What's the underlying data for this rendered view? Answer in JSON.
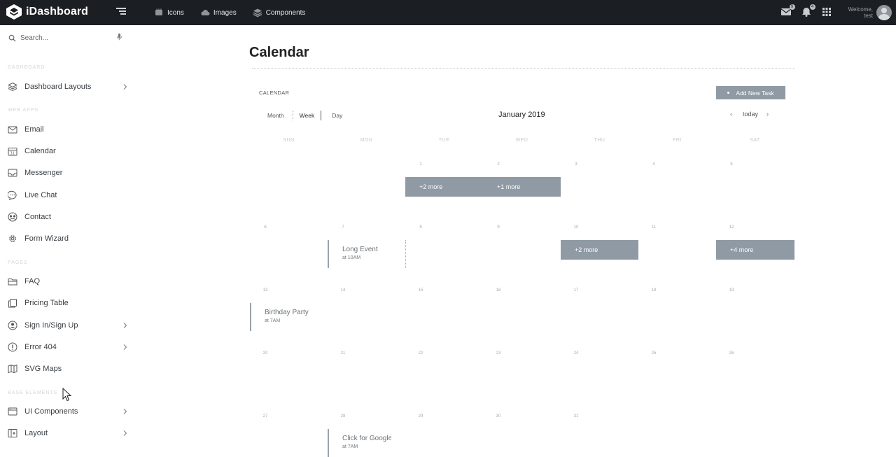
{
  "topbar": {
    "brand": "iDashboard",
    "nav": [
      {
        "label": "Icons",
        "icon": "icons-icon"
      },
      {
        "label": "Images",
        "icon": "cloud-icon"
      },
      {
        "label": "Components",
        "icon": "layers-icon"
      }
    ],
    "mail_badge": "9",
    "bell_badge": "4",
    "welcome": "Welcome,",
    "username": "test"
  },
  "sidebar": {
    "search_placeholder": "Search...",
    "sections": {
      "dashboard": "DASHBOARD",
      "web_apps": "WEB APPS",
      "pages": "PAGES",
      "base_elements": "BASE ELEMENTS"
    },
    "items": [
      {
        "label": "Dashboard Layouts",
        "icon": "layers-icon",
        "has_children": true
      },
      {
        "label": "Email",
        "icon": "mail-icon"
      },
      {
        "label": "Calendar",
        "icon": "calendar-icon"
      },
      {
        "label": "Messenger",
        "icon": "inbox-icon"
      },
      {
        "label": "Live Chat",
        "icon": "chat-icon"
      },
      {
        "label": "Contact",
        "icon": "contact-icon"
      },
      {
        "label": "Form Wizard",
        "icon": "settings-icon"
      },
      {
        "label": "FAQ",
        "icon": "folder-icon"
      },
      {
        "label": "Pricing Table",
        "icon": "copy-icon"
      },
      {
        "label": "Sign In/Sign Up",
        "icon": "user-icon",
        "has_children": true
      },
      {
        "label": "Error 404",
        "icon": "error-icon",
        "has_children": true
      },
      {
        "label": "SVG Maps",
        "icon": "map-icon"
      },
      {
        "label": "UI Components",
        "icon": "window-icon",
        "has_children": true
      },
      {
        "label": "Layout",
        "icon": "layout-icon",
        "has_children": true
      }
    ]
  },
  "main": {
    "title": "Calendar",
    "calendar_label": "CALENDAR",
    "add_task": "Add New Task",
    "views": [
      "Month",
      "Week",
      "Day"
    ],
    "month_title": "January 2019",
    "today": "today",
    "prev": "‹",
    "next": "›",
    "weekdays": [
      "SUN",
      "MON",
      "TUE",
      "WED",
      "THU",
      "FRI",
      "SAT"
    ],
    "weeks": [
      [
        "",
        "",
        "1",
        "2",
        "3",
        "4",
        "5"
      ],
      [
        "6",
        "7",
        "8",
        "9",
        "10",
        "11",
        "12"
      ],
      [
        "13",
        "14",
        "15",
        "16",
        "17",
        "18",
        "19"
      ],
      [
        "20",
        "21",
        "22",
        "23",
        "24",
        "25",
        "26"
      ],
      [
        "27",
        "28",
        "29",
        "30",
        "31",
        "",
        ""
      ]
    ],
    "more_links": [
      "+2 more",
      "+1 more",
      "+2 more",
      "+4 more"
    ],
    "events": [
      {
        "title": "Long Event",
        "time": "at 10AM"
      },
      {
        "title": "Birthday Party",
        "time": "at 7AM"
      },
      {
        "title": "Click for Google",
        "time": "at 7AM"
      }
    ]
  }
}
